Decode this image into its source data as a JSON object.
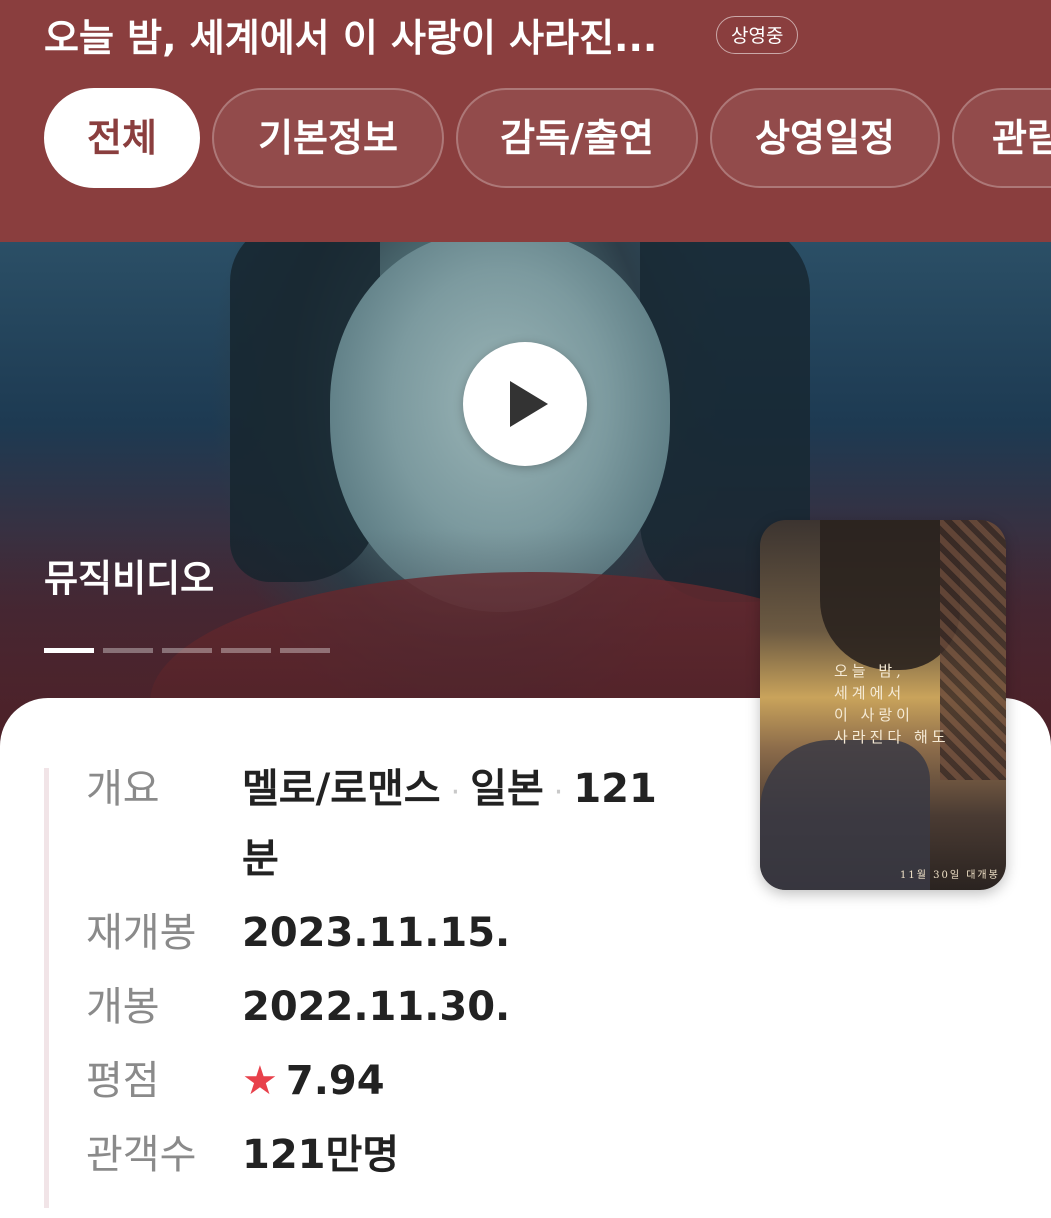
{
  "header": {
    "title": "오늘 밤, 세계에서 이 사랑이 사라진...",
    "status_badge": "상영중",
    "tabs": [
      {
        "label": "전체",
        "active": true
      },
      {
        "label": "기본정보",
        "active": false
      },
      {
        "label": "감독/출연",
        "active": false
      },
      {
        "label": "상영일정",
        "active": false
      },
      {
        "label": "관람",
        "active": false
      }
    ]
  },
  "hero": {
    "caption": "뮤직비디오",
    "play_icon": "play-icon",
    "slides_total": 5,
    "active_slide": 1
  },
  "poster": {
    "title_text": "오늘 밤,\n세계에서\n이 사랑이\n사라진다 해도",
    "date_text": "11월 30일 대개봉"
  },
  "info": {
    "overview_label": "개요",
    "genre": "멜로/로맨스",
    "sep1": "·",
    "country": "일본",
    "sep2": "·",
    "runtime_line1": "121",
    "runtime_line2": "분",
    "rerelease_label": "재개봉",
    "rerelease_date": "2023.11.15.",
    "release_label": "개봉",
    "release_date": "2022.11.30.",
    "rating_label": "평점",
    "rating_icon": "★",
    "rating_value": "7.94",
    "audience_label": "관객수",
    "audience_value": "121만명"
  },
  "colors": {
    "header_bg": "#8a3e3e",
    "star": "#e8414b"
  }
}
